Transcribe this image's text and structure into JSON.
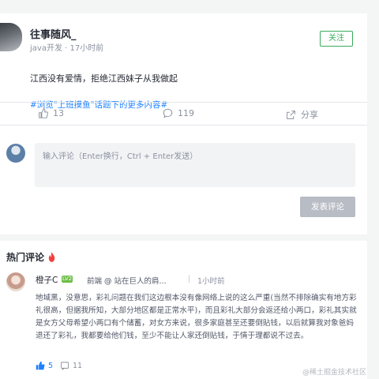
{
  "post": {
    "author": "往事随风_",
    "role": "java开发",
    "dot": " · ",
    "time": "17小时前",
    "follow_label": "关注",
    "content": "江西没有爱情，拒绝江西妹子从我做起",
    "topic_link": "#浏览\"上班摸鱼\"话题下的更多内容#",
    "actions": {
      "likes": "13",
      "comments": "119",
      "share_label": "分享"
    }
  },
  "comment_box": {
    "placeholder": "输入评论（Enter换行，Ctrl + Enter发送）",
    "submit_label": "发表评论"
  },
  "hot_comments": {
    "title": "热门评论",
    "items": [
      {
        "author": "橙子C",
        "level": "LV2",
        "role": "前端 @ 站在巨人的肩...",
        "separator": "|",
        "time": "1小时前",
        "content": "地域黑，没意思，彩礼问题在我们这边根本没有像网络上说的这么严重(当然不排除确实有地方彩礼很高，但据我所知，大部分地区都是正常水平)，而且彩礼大部分会返还给小两口，彩礼其实就是女方父母希望小两口有个储蓄，对女方来说，很多家庭甚至还要倒贴钱，以后就算我对象爸妈退还了彩礼，我都要给他们钱，至少不能让人家还倒贴钱，于情于理都说不过去。",
        "likes": "5",
        "replies": "11"
      }
    ]
  },
  "watermark": "@稀土掘金技术社区",
  "colors": {
    "accent": "#1e80ff",
    "follow_green": "#37ac5c",
    "muted": "#8a919f",
    "fire": "#f53f3f"
  }
}
